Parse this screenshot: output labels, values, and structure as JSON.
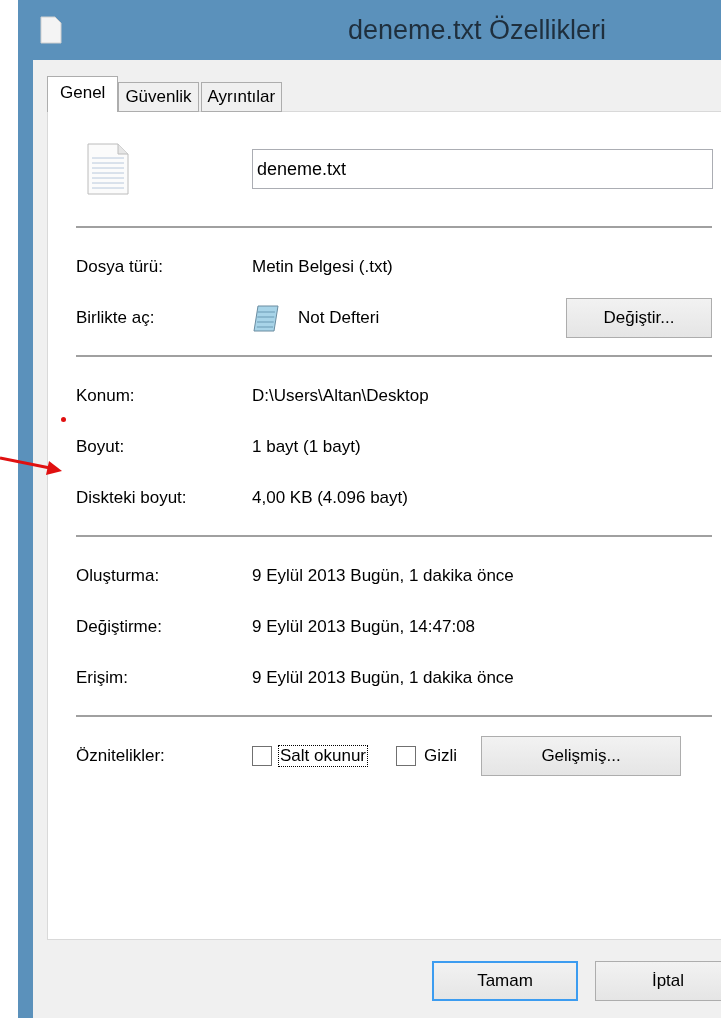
{
  "window": {
    "title": "deneme.txt Özellikleri"
  },
  "tabs": [
    {
      "label": "Genel",
      "selected": true
    },
    {
      "label": "Güvenlik",
      "selected": false
    },
    {
      "label": "Ayrıntılar",
      "selected": false
    }
  ],
  "file_name": {
    "value": "deneme.txt"
  },
  "sections": [
    [
      {
        "label": "Dosya türü:",
        "value": "Metin Belgesi (.txt)",
        "kind": "text"
      },
      {
        "label": "Birlikte aç:",
        "value": "Not Defteri",
        "kind": "app",
        "button": "Değiştir..."
      }
    ],
    [
      {
        "label": "Konum:",
        "value": "D:\\Users\\Altan\\Desktop",
        "kind": "text"
      },
      {
        "label": "Boyut:",
        "value": "1 bayt (1 bayt)",
        "kind": "text"
      },
      {
        "label": "Diskteki boyut:",
        "value": "4,00 KB (4.096 bayt)",
        "kind": "text"
      }
    ],
    [
      {
        "label": "Oluşturma:",
        "value": "9 Eylül 2013 Bugün, 1 dakika önce",
        "kind": "text"
      },
      {
        "label": "Değiştirme:",
        "value": "9 Eylül 2013 Bugün, 14:47:08",
        "kind": "text"
      },
      {
        "label": "Erişim:",
        "value": "9 Eylül 2013 Bugün, 1 dakika önce",
        "kind": "text"
      }
    ]
  ],
  "attributes": {
    "label": "Öznitelikler:",
    "checkboxes": [
      {
        "label": "Salt okunur",
        "checked": false,
        "focused": true
      },
      {
        "label": "Gizli",
        "checked": false,
        "focused": false
      }
    ],
    "button": "Gelişmiş..."
  },
  "buttons": [
    {
      "label": "Tamam",
      "default": true
    },
    {
      "label": "İptal",
      "default": false
    }
  ]
}
